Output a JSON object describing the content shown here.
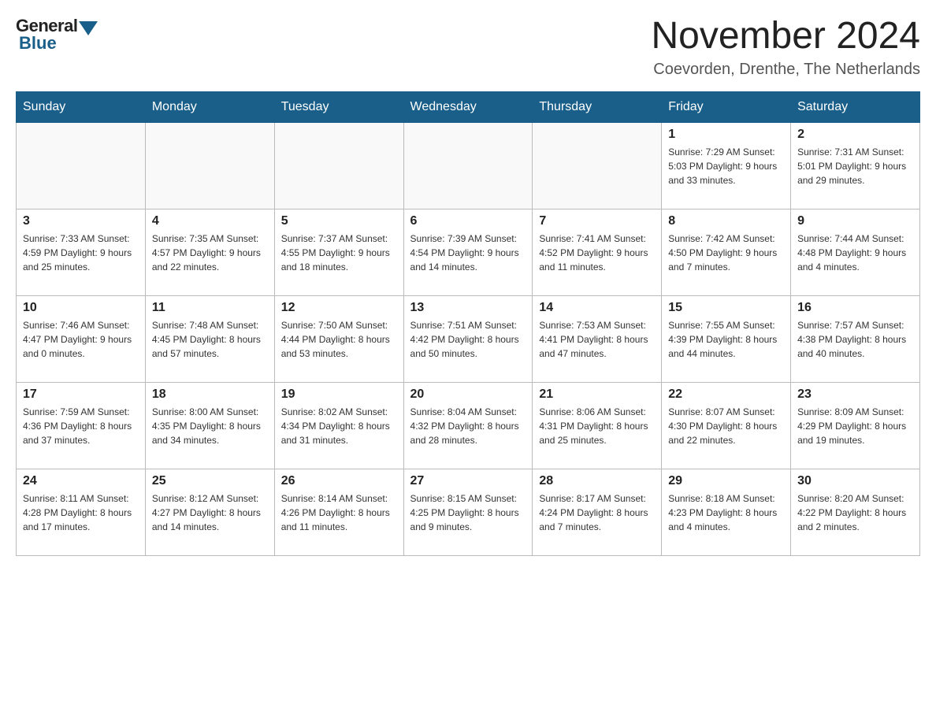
{
  "header": {
    "logo_general": "General",
    "logo_blue": "Blue",
    "month_title": "November 2024",
    "location": "Coevorden, Drenthe, The Netherlands"
  },
  "days_of_week": [
    "Sunday",
    "Monday",
    "Tuesday",
    "Wednesday",
    "Thursday",
    "Friday",
    "Saturday"
  ],
  "weeks": [
    {
      "days": [
        {
          "date": "",
          "info": ""
        },
        {
          "date": "",
          "info": ""
        },
        {
          "date": "",
          "info": ""
        },
        {
          "date": "",
          "info": ""
        },
        {
          "date": "",
          "info": ""
        },
        {
          "date": "1",
          "info": "Sunrise: 7:29 AM\nSunset: 5:03 PM\nDaylight: 9 hours and 33 minutes."
        },
        {
          "date": "2",
          "info": "Sunrise: 7:31 AM\nSunset: 5:01 PM\nDaylight: 9 hours and 29 minutes."
        }
      ]
    },
    {
      "days": [
        {
          "date": "3",
          "info": "Sunrise: 7:33 AM\nSunset: 4:59 PM\nDaylight: 9 hours and 25 minutes."
        },
        {
          "date": "4",
          "info": "Sunrise: 7:35 AM\nSunset: 4:57 PM\nDaylight: 9 hours and 22 minutes."
        },
        {
          "date": "5",
          "info": "Sunrise: 7:37 AM\nSunset: 4:55 PM\nDaylight: 9 hours and 18 minutes."
        },
        {
          "date": "6",
          "info": "Sunrise: 7:39 AM\nSunset: 4:54 PM\nDaylight: 9 hours and 14 minutes."
        },
        {
          "date": "7",
          "info": "Sunrise: 7:41 AM\nSunset: 4:52 PM\nDaylight: 9 hours and 11 minutes."
        },
        {
          "date": "8",
          "info": "Sunrise: 7:42 AM\nSunset: 4:50 PM\nDaylight: 9 hours and 7 minutes."
        },
        {
          "date": "9",
          "info": "Sunrise: 7:44 AM\nSunset: 4:48 PM\nDaylight: 9 hours and 4 minutes."
        }
      ]
    },
    {
      "days": [
        {
          "date": "10",
          "info": "Sunrise: 7:46 AM\nSunset: 4:47 PM\nDaylight: 9 hours and 0 minutes."
        },
        {
          "date": "11",
          "info": "Sunrise: 7:48 AM\nSunset: 4:45 PM\nDaylight: 8 hours and 57 minutes."
        },
        {
          "date": "12",
          "info": "Sunrise: 7:50 AM\nSunset: 4:44 PM\nDaylight: 8 hours and 53 minutes."
        },
        {
          "date": "13",
          "info": "Sunrise: 7:51 AM\nSunset: 4:42 PM\nDaylight: 8 hours and 50 minutes."
        },
        {
          "date": "14",
          "info": "Sunrise: 7:53 AM\nSunset: 4:41 PM\nDaylight: 8 hours and 47 minutes."
        },
        {
          "date": "15",
          "info": "Sunrise: 7:55 AM\nSunset: 4:39 PM\nDaylight: 8 hours and 44 minutes."
        },
        {
          "date": "16",
          "info": "Sunrise: 7:57 AM\nSunset: 4:38 PM\nDaylight: 8 hours and 40 minutes."
        }
      ]
    },
    {
      "days": [
        {
          "date": "17",
          "info": "Sunrise: 7:59 AM\nSunset: 4:36 PM\nDaylight: 8 hours and 37 minutes."
        },
        {
          "date": "18",
          "info": "Sunrise: 8:00 AM\nSunset: 4:35 PM\nDaylight: 8 hours and 34 minutes."
        },
        {
          "date": "19",
          "info": "Sunrise: 8:02 AM\nSunset: 4:34 PM\nDaylight: 8 hours and 31 minutes."
        },
        {
          "date": "20",
          "info": "Sunrise: 8:04 AM\nSunset: 4:32 PM\nDaylight: 8 hours and 28 minutes."
        },
        {
          "date": "21",
          "info": "Sunrise: 8:06 AM\nSunset: 4:31 PM\nDaylight: 8 hours and 25 minutes."
        },
        {
          "date": "22",
          "info": "Sunrise: 8:07 AM\nSunset: 4:30 PM\nDaylight: 8 hours and 22 minutes."
        },
        {
          "date": "23",
          "info": "Sunrise: 8:09 AM\nSunset: 4:29 PM\nDaylight: 8 hours and 19 minutes."
        }
      ]
    },
    {
      "days": [
        {
          "date": "24",
          "info": "Sunrise: 8:11 AM\nSunset: 4:28 PM\nDaylight: 8 hours and 17 minutes."
        },
        {
          "date": "25",
          "info": "Sunrise: 8:12 AM\nSunset: 4:27 PM\nDaylight: 8 hours and 14 minutes."
        },
        {
          "date": "26",
          "info": "Sunrise: 8:14 AM\nSunset: 4:26 PM\nDaylight: 8 hours and 11 minutes."
        },
        {
          "date": "27",
          "info": "Sunrise: 8:15 AM\nSunset: 4:25 PM\nDaylight: 8 hours and 9 minutes."
        },
        {
          "date": "28",
          "info": "Sunrise: 8:17 AM\nSunset: 4:24 PM\nDaylight: 8 hours and 7 minutes."
        },
        {
          "date": "29",
          "info": "Sunrise: 8:18 AM\nSunset: 4:23 PM\nDaylight: 8 hours and 4 minutes."
        },
        {
          "date": "30",
          "info": "Sunrise: 8:20 AM\nSunset: 4:22 PM\nDaylight: 8 hours and 2 minutes."
        }
      ]
    }
  ]
}
